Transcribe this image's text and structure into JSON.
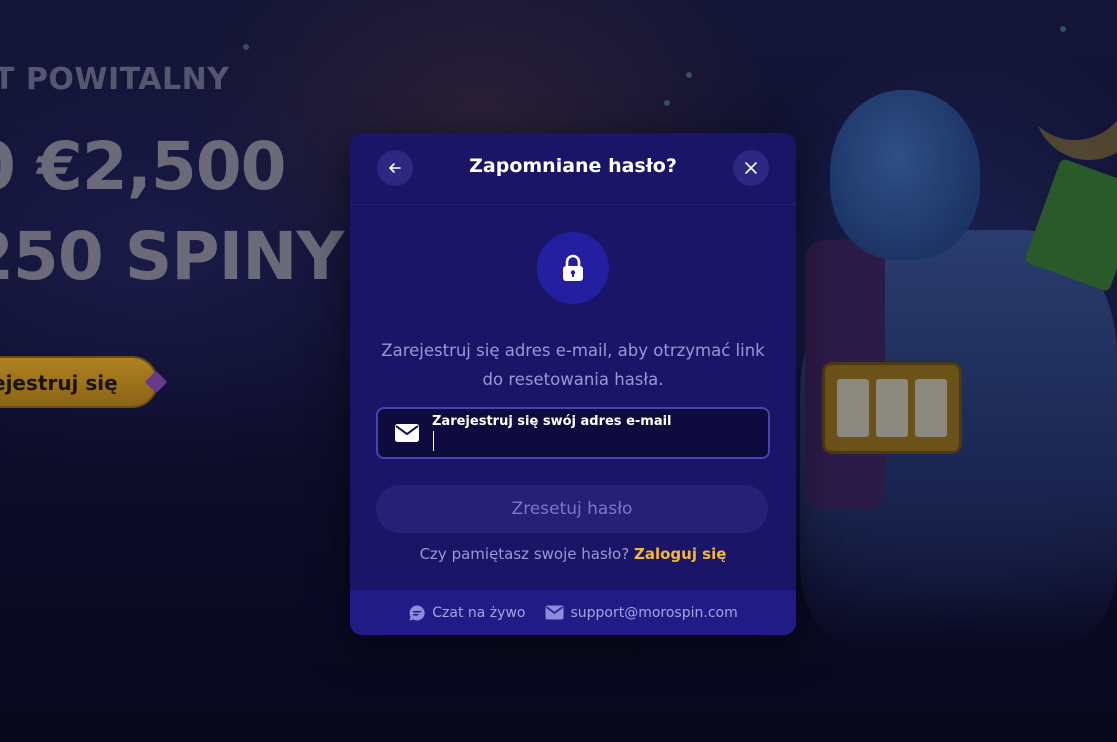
{
  "background": {
    "eyebrow": "T POWITALNY",
    "headline_line1": "0 €2,500",
    "headline_line2": "250 SPINY",
    "cta_label": "ejestruj się"
  },
  "modal": {
    "title": "Zapomniane hasło?",
    "back_icon": "arrow-left-icon",
    "close_icon": "close-icon",
    "lock_icon": "lock-icon",
    "description": "Zarejestruj się adres e-mail, aby otrzymać link do resetowania hasła.",
    "email_field": {
      "label": "Zarejestruj się swój adres e-mail",
      "value": "",
      "icon": "envelope-icon"
    },
    "reset_button_label": "Zresetuj hasło",
    "login_prompt": "Czy pamiętasz swoje hasło?",
    "login_link": "Zaloguj się",
    "footer": {
      "chat_label": "Czat na żywo",
      "chat_icon": "chat-bubble-icon",
      "email_label": "support@morospin.com",
      "email_icon": "envelope-icon"
    }
  },
  "colors": {
    "modal_bg": "#1a1566",
    "accent_link": "#f5b82e",
    "button_bg": "#262076",
    "input_border": "#4842b4"
  }
}
